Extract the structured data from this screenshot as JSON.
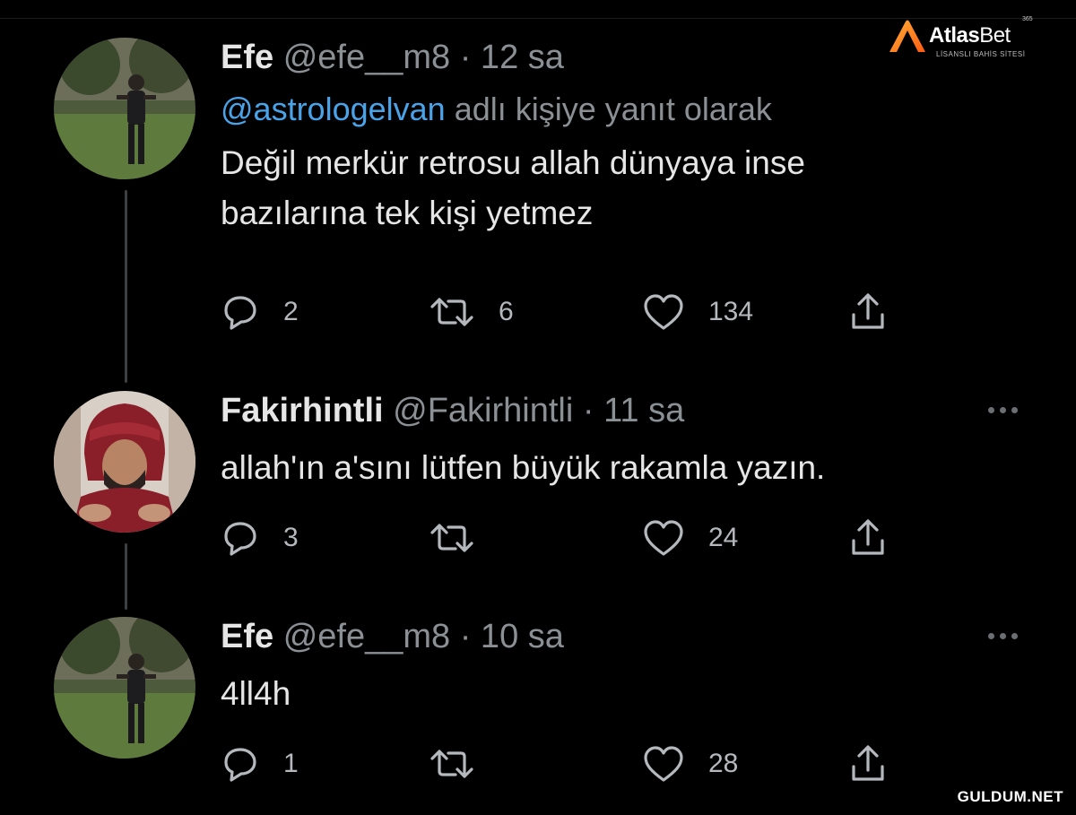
{
  "brand": {
    "name_part1": "Atlas",
    "name_part2": "Bet",
    "tagline": "LİSANSLI BAHİS SİTESİ",
    "badge": "365",
    "accent_color": "#ff7a1a"
  },
  "tweets": [
    {
      "name": "Efe",
      "handle_time": "@efe__m8 · 12 sa",
      "reply_mention": "@astrologelvan",
      "reply_suffix": "adlı kişiye yanıt olarak",
      "text_line1": "Değil merkür retrosu allah dünyaya inse",
      "text_line2": "bazılarına tek kişi yetmez",
      "replies": "2",
      "retweets": "6",
      "likes": "134",
      "avatar": "person-in-garden-avatar"
    },
    {
      "name": "Fakirhintli",
      "handle_time": "@Fakirhintli · 11 sa",
      "text_line1": "allah'ın a'sını lütfen büyük rakamla yazın.",
      "replies": "3",
      "retweets": "",
      "likes": "24",
      "avatar": "turban-man-avatar"
    },
    {
      "name": "Efe",
      "handle_time": "@efe__m8 · 10 sa",
      "text_line1": "4ll4h",
      "replies": "1",
      "retweets": "",
      "likes": "28",
      "avatar": "person-in-garden-avatar"
    }
  ],
  "icons": {
    "reply": "reply-icon",
    "retweet": "retweet-icon",
    "like": "heart-icon",
    "share": "share-icon",
    "more": "more-dots-icon"
  },
  "colors": {
    "background": "#000000",
    "mention": "#4aa3e8",
    "muted": "#8b9095",
    "text": "#e6e6e6"
  },
  "watermark": "GULDUM.NET"
}
